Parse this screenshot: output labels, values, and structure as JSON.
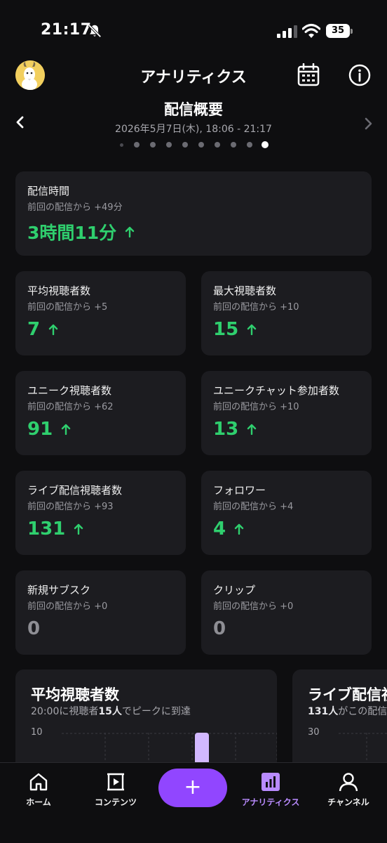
{
  "status": {
    "time": "21:17",
    "battery": "35"
  },
  "header": {
    "title": "アナリティクス"
  },
  "summary": {
    "title": "配信概要",
    "date_range": "2026年5月7日(木), 18:06 - 21:17",
    "page_count": 10,
    "active_page": 9
  },
  "stream_time": {
    "label": "配信時間",
    "delta": "前回の配信から +49分",
    "value": "3時間11分"
  },
  "metrics": [
    {
      "label": "平均視聴者数",
      "delta": "前回の配信から +5",
      "value": "7",
      "trend": "up"
    },
    {
      "label": "最大視聴者数",
      "delta": "前回の配信から +10",
      "value": "15",
      "trend": "up"
    },
    {
      "label": "ユニーク視聴者数",
      "delta": "前回の配信から +62",
      "value": "91",
      "trend": "up"
    },
    {
      "label": "ユニークチャット参加者数",
      "delta": "前回の配信から +10",
      "value": "13",
      "trend": "up"
    },
    {
      "label": "ライブ配信視聴者数",
      "delta": "前回の配信から +93",
      "value": "131",
      "trend": "up"
    },
    {
      "label": "フォロワー",
      "delta": "前回の配信から +4",
      "value": "4",
      "trend": "up"
    },
    {
      "label": "新規サブスク",
      "delta": "前回の配信から +0",
      "value": "0",
      "trend": "none"
    },
    {
      "label": "クリップ",
      "delta": "前回の配信から +0",
      "value": "0",
      "trend": "none"
    }
  ],
  "charts": [
    {
      "title": "平均視聴者数",
      "subtitle_pre": "20:00に視聴者",
      "subtitle_bold": "15人",
      "subtitle_post": "でピークに到達",
      "y_max_label": "10",
      "chart_data": {
        "type": "bar",
        "ylim": [
          0,
          10
        ],
        "peak_value": 15,
        "peak_time": "20:00"
      }
    },
    {
      "title": "ライブ配信視",
      "subtitle_pre": "",
      "subtitle_bold": "131人",
      "subtitle_post": "がこの配信",
      "y_max_label": "30"
    }
  ],
  "nav": {
    "home": "ホーム",
    "content": "コンテンツ",
    "add": "+",
    "analytics": "アナリティクス",
    "channel": "チャンネル"
  },
  "colors": {
    "accent": "#9146ff",
    "positive": "#2fcf6e",
    "card": "#1c1c20",
    "background": "#0e0e10"
  }
}
